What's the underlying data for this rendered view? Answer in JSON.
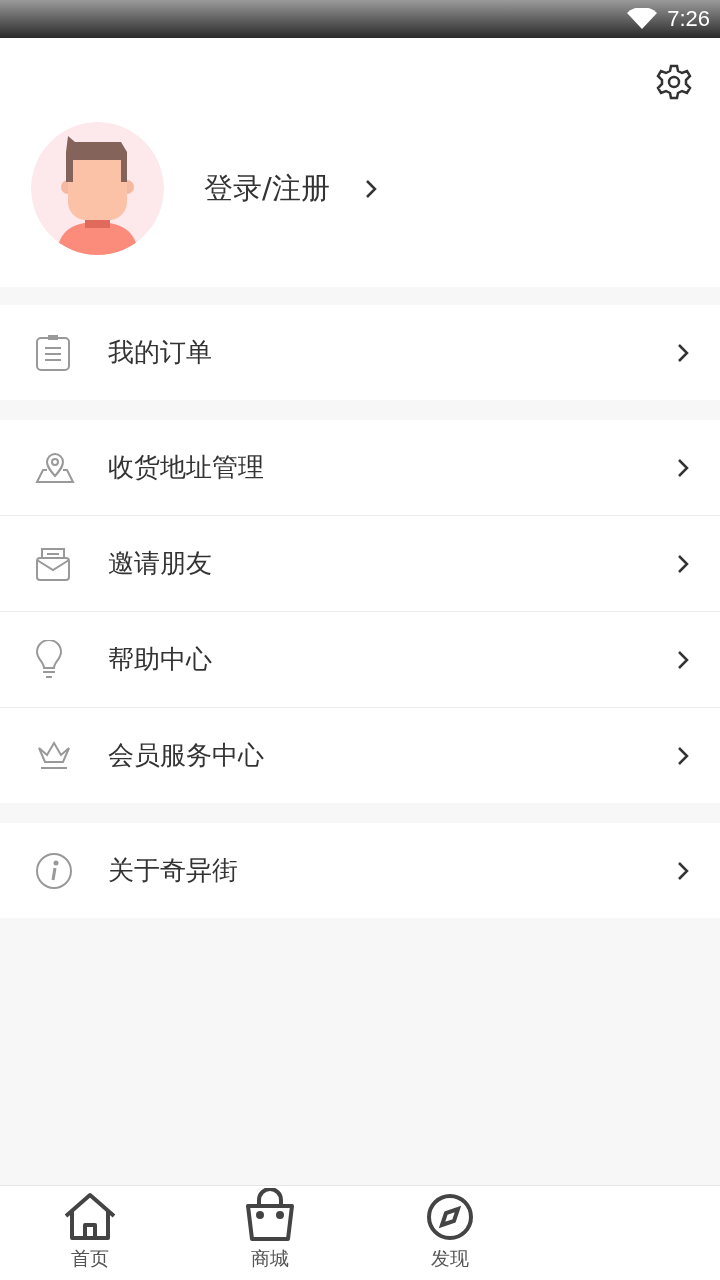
{
  "status_bar": {
    "time": "7:26"
  },
  "profile": {
    "login_label": "登录/注册"
  },
  "menu_groups": [
    {
      "items": [
        {
          "kind": "clipboard",
          "label": "我的订单"
        }
      ]
    },
    {
      "items": [
        {
          "kind": "map-pin",
          "label": "收货地址管理"
        },
        {
          "kind": "envelope",
          "label": "邀请朋友"
        },
        {
          "kind": "bulb",
          "label": "帮助中心"
        },
        {
          "kind": "crown",
          "label": "会员服务中心"
        }
      ]
    },
    {
      "items": [
        {
          "kind": "info",
          "label": "关于奇异街"
        }
      ]
    }
  ],
  "bottom_nav": [
    {
      "kind": "home",
      "label": "首页",
      "selected": false
    },
    {
      "kind": "bag",
      "label": "商城",
      "selected": false
    },
    {
      "kind": "discover",
      "label": "发现",
      "selected": false
    }
  ]
}
